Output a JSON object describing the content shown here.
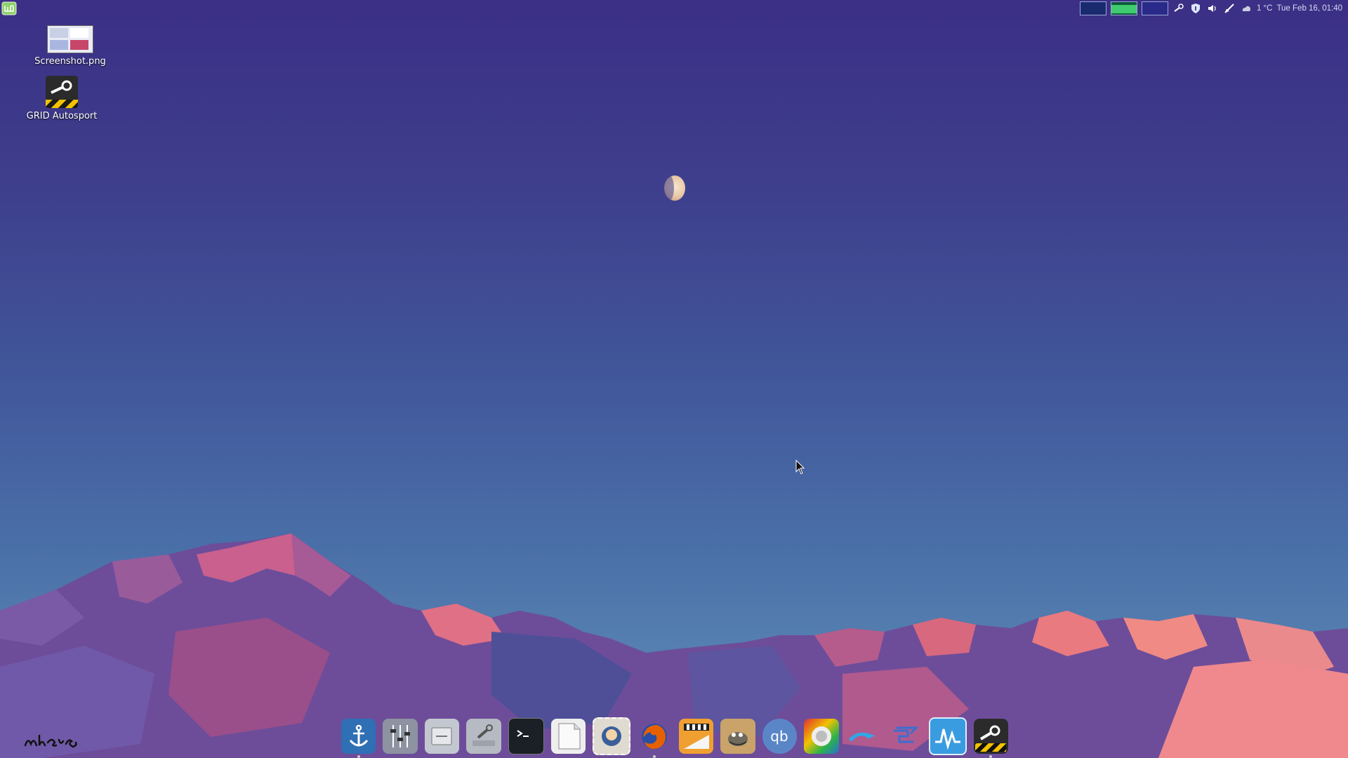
{
  "taskbar": {
    "menu_icon": "linux-mint-menu-icon",
    "tray": {
      "graphs": [
        "cpu-graph",
        "memory-graph",
        "network-graph"
      ],
      "icons": [
        "steam-tray-icon",
        "shield-tray-icon",
        "volume-icon",
        "network-icon",
        "weather-icon"
      ],
      "weather_text": "1 °C",
      "clock": "Tue Feb 16, 01:40"
    }
  },
  "desktop": {
    "icons": [
      {
        "label": "Screenshot.png",
        "icon": "image-file-icon"
      },
      {
        "label": "GRID Autosport",
        "icon": "steam-game-icon"
      }
    ]
  },
  "dock": {
    "items": [
      {
        "name": "dock-anchor",
        "icon": "anchor-icon",
        "color": "#3a8fd8"
      },
      {
        "name": "dock-mixer",
        "icon": "mixer-settings-icon",
        "color": "#9aa0ad"
      },
      {
        "name": "dock-files",
        "icon": "file-manager-icon",
        "color": "#c7cbd2"
      },
      {
        "name": "dock-tools",
        "icon": "tools-icon",
        "color": "#b8bcc4"
      },
      {
        "name": "dock-terminal",
        "icon": "terminal-icon",
        "color": "#1b1f26"
      },
      {
        "name": "dock-text-editor",
        "icon": "text-editor-icon",
        "color": "#f2f2f2"
      },
      {
        "name": "dock-mail",
        "icon": "mail-stamp-icon",
        "color": "#d6cfc0"
      },
      {
        "name": "dock-firefox",
        "icon": "firefox-icon",
        "color": "#e66000"
      },
      {
        "name": "dock-video-editor",
        "icon": "clapperboard-icon",
        "color": "#f0a030"
      },
      {
        "name": "dock-gimp",
        "icon": "gimp-icon",
        "color": "#c9a36a"
      },
      {
        "name": "dock-qbittorrent",
        "icon": "qbittorrent-icon",
        "color": "#4f7ec6"
      },
      {
        "name": "dock-steam-link",
        "icon": "chromium-steam-icon",
        "color": "#d0d0d0"
      },
      {
        "name": "dock-dolphin",
        "icon": "dolphin-emulator-icon",
        "color": "#2fa8e8"
      },
      {
        "name": "dock-pcsx2",
        "icon": "pcsx2-icon",
        "color": "#3a6fd0"
      },
      {
        "name": "dock-system-monitor",
        "icon": "system-monitor-icon",
        "color": "#3a9ce0"
      },
      {
        "name": "dock-steam",
        "icon": "steam-game-icon",
        "color": "#2b2b2b"
      }
    ]
  },
  "signature_text": "nhers"
}
